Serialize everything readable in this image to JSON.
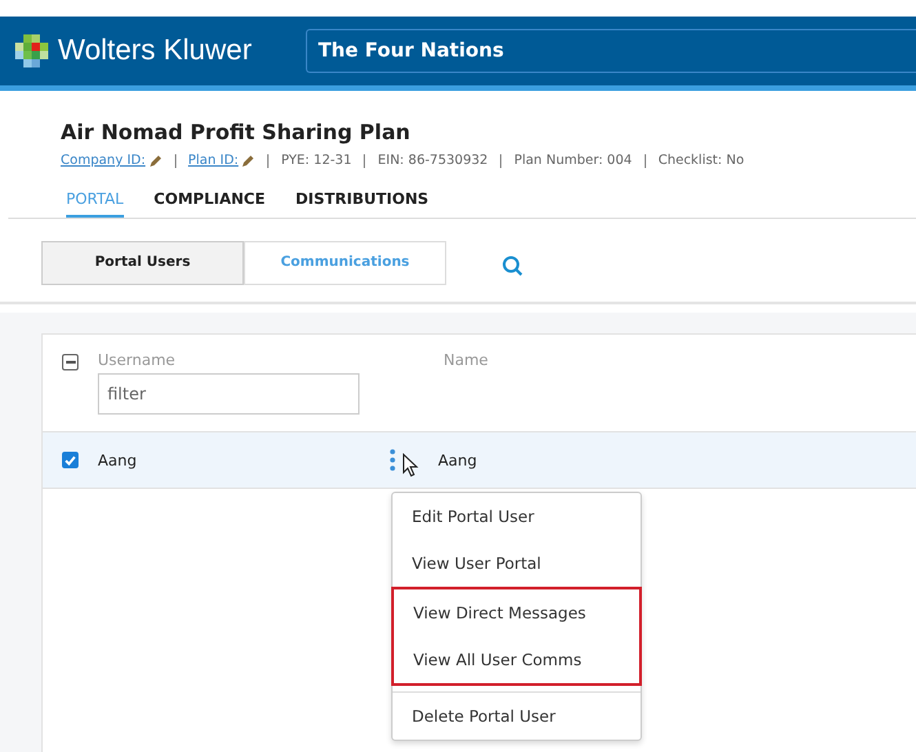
{
  "header": {
    "brand": "Wolters Kluwer",
    "client_selector": "The Four Nations"
  },
  "plan": {
    "title": "Air Nomad Profit Sharing Plan",
    "links": [
      "Company ID:",
      "Plan ID:"
    ],
    "meta": [
      "PYE: 12-31",
      "EIN: 86-7530932",
      "Plan Number: 004",
      "Checklist: No"
    ]
  },
  "tabs": [
    {
      "label": "PORTAL",
      "selected": true
    },
    {
      "label": "COMPLIANCE",
      "selected": false
    },
    {
      "label": "DISTRIBUTIONS",
      "selected": false
    }
  ],
  "sub_tabs": [
    {
      "label": "Portal Users",
      "selected": true
    },
    {
      "label": "Communications",
      "selected": false
    }
  ],
  "table": {
    "columns": [
      "Username",
      "Name"
    ],
    "filter_placeholder": "filter",
    "select_all_indeterminate": true,
    "rows": [
      {
        "username": "Aang",
        "name": "Aang",
        "checked": true
      }
    ]
  },
  "context_menu": [
    {
      "label": "Edit Portal User",
      "highlighted": false,
      "divider": false
    },
    {
      "label": "View User Portal",
      "highlighted": false,
      "divider": false
    },
    {
      "label": "View Direct Messages",
      "highlighted": true,
      "divider": false
    },
    {
      "label": "View All User Comms",
      "highlighted": true,
      "divider": false
    },
    {
      "label": "Delete Portal User",
      "highlighted": false,
      "divider": true
    }
  ]
}
